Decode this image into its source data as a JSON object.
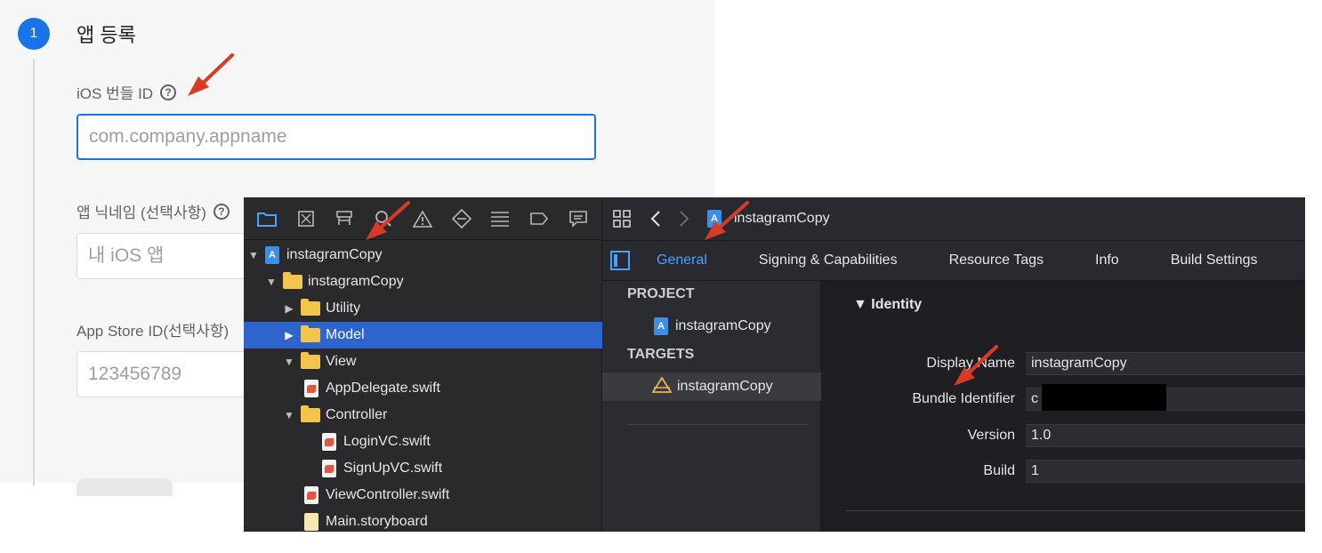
{
  "firebase": {
    "step_number": "1",
    "step_title": "앱 등록",
    "bundle_id_label": "iOS 번들 ID",
    "bundle_id_placeholder": "com.company.appname",
    "nickname_label": "앱 닉네임 (선택사항)",
    "nickname_placeholder": "내 iOS 앱",
    "appstore_label": "App Store ID(선택사항)",
    "appstore_placeholder": "123456789",
    "help_glyph": "?",
    "accent_color": "#1a73e8"
  },
  "xcode": {
    "navigator": {
      "toolbar_icons": [
        "folder-icon",
        "source-control-icon",
        "hierarchy-icon",
        "find-icon",
        "warning-icon",
        "test-icon",
        "debug-icon",
        "breakpoint-icon",
        "report-icon"
      ],
      "tree": [
        {
          "label": "instagramCopy",
          "kind": "project",
          "disclosure": "▼"
        },
        {
          "label": "instagramCopy",
          "kind": "folder",
          "disclosure": "▼"
        },
        {
          "label": "Utility",
          "kind": "folder",
          "disclosure": "▶"
        },
        {
          "label": "Model",
          "kind": "folder",
          "disclosure": "▶",
          "selected": true
        },
        {
          "label": "View",
          "kind": "folder",
          "disclosure": "▼"
        },
        {
          "label": "AppDelegate.swift",
          "kind": "swift"
        },
        {
          "label": "Controller",
          "kind": "folder",
          "disclosure": "▼"
        },
        {
          "label": "LoginVC.swift",
          "kind": "swift"
        },
        {
          "label": "SignUpVC.swift",
          "kind": "swift"
        },
        {
          "label": "ViewController.swift",
          "kind": "swift"
        },
        {
          "label": "Main.storyboard",
          "kind": "storyboard"
        }
      ]
    },
    "editor": {
      "breadcrumb": "instagramCopy",
      "tabs": [
        "General",
        "Signing & Capabilities",
        "Resource Tags",
        "Info",
        "Build Settings"
      ],
      "active_tab": "General",
      "project_heading": "PROJECT",
      "project_item": "instagramCopy",
      "targets_heading": "TARGETS",
      "target_item": "instagramCopy",
      "identity_heading": "▼  Identity",
      "fields": {
        "display_name_label": "Display Name",
        "display_name_value": "instagramCopy",
        "bundle_id_label": "Bundle Identifier",
        "bundle_id_value": "c                                Copy",
        "version_label": "Version",
        "version_value": "1.0",
        "build_label": "Build",
        "build_value": "1"
      },
      "accent_color": "#4aa2ff"
    }
  },
  "annotation_color": "#d93a26"
}
